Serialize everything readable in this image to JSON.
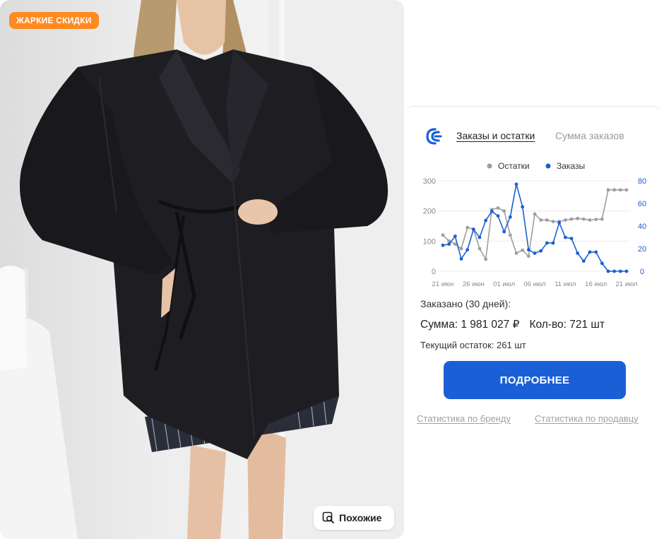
{
  "product": {
    "badge": "ЖАРКИЕ СКИДКИ",
    "similar_button": "Похожие",
    "similar_icon": "search-image-icon"
  },
  "widget": {
    "logo_icon": "bracket-logo-icon",
    "tabs": [
      {
        "label": "Заказы и остатки",
        "active": true
      },
      {
        "label": "Сумма заказов",
        "active": false
      }
    ],
    "ordered_title": "Заказано (30 дней):",
    "sum_text": "Сумма: 1 981 027 ₽",
    "qty_text": "Кол-во: 721 шт",
    "stock_text": "Текущий остаток: 261 шт",
    "more_button": "ПОДРОБНЕЕ",
    "links": {
      "brand": "Статистика по бренду",
      "seller": "Статистика по продавцу"
    },
    "colors": {
      "accent": "#1a5fd6",
      "badge": "#ff8a1f",
      "stock_series": "#9e9e9e",
      "orders_series": "#1a5fd6"
    }
  },
  "chart_data": {
    "type": "line",
    "x": [
      "21 июн",
      "22 июн",
      "23 июн",
      "24 июн",
      "25 июн",
      "26 июн",
      "27 июн",
      "28 июн",
      "29 июн",
      "30 июн",
      "01 июл",
      "02 июл",
      "03 июл",
      "04 июл",
      "05 июл",
      "06 июл",
      "07 июл",
      "08 июл",
      "09 июл",
      "10 июл",
      "11 июл",
      "12 июл",
      "13 июл",
      "14 июл",
      "15 июл",
      "16 июл",
      "17 июл",
      "18 июл",
      "19 июл",
      "20 июл",
      "21 июл"
    ],
    "x_tick_labels": [
      "21 июн",
      "26 июн",
      "01 июл",
      "06 июл",
      "11 июл",
      "16 июл",
      "21 июл"
    ],
    "series": [
      {
        "name": "Остатки",
        "axis": "left",
        "values": [
          120,
          100,
          90,
          75,
          145,
          140,
          75,
          40,
          205,
          210,
          200,
          120,
          60,
          70,
          50,
          190,
          170,
          170,
          165,
          165,
          170,
          173,
          175,
          173,
          170,
          172,
          173,
          270,
          270,
          270,
          270
        ]
      },
      {
        "name": "Заказы",
        "axis": "right",
        "values": [
          23,
          24,
          31,
          11,
          19,
          37,
          30,
          45,
          53,
          49,
          35,
          48,
          77,
          57,
          19,
          16,
          18,
          25,
          25,
          43,
          30,
          29,
          16,
          9,
          17,
          17,
          7,
          0,
          0,
          0,
          0
        ]
      }
    ],
    "y_left": {
      "ticks": [
        0,
        100,
        200,
        300
      ],
      "ylim": [
        0,
        300
      ]
    },
    "y_right": {
      "ticks": [
        0,
        20,
        40,
        60,
        80
      ],
      "ylim": [
        0,
        80
      ]
    },
    "legend": "top"
  }
}
